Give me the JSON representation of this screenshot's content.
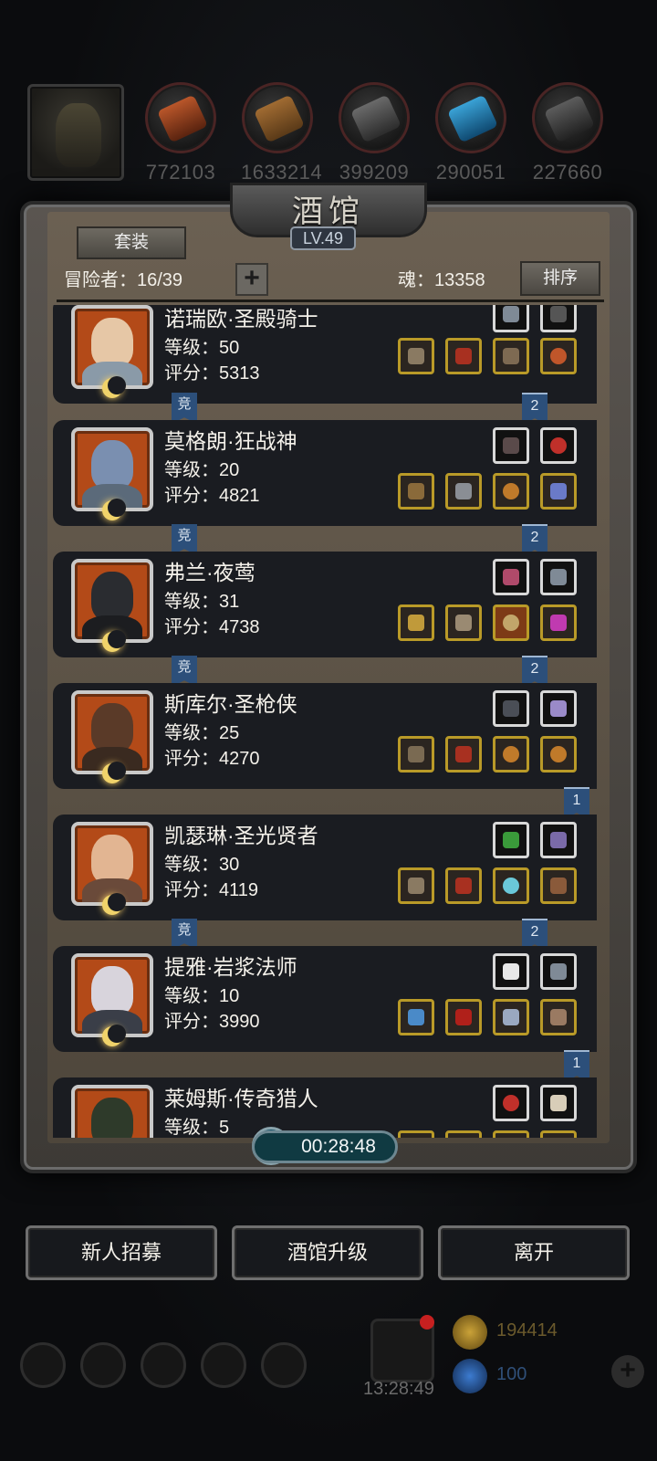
{
  "resources": [
    {
      "icon": "meat-icon",
      "value": "772103"
    },
    {
      "icon": "wood-icon",
      "value": "1633214"
    },
    {
      "icon": "stone-icon",
      "value": "399209"
    },
    {
      "icon": "crystal-icon",
      "value": "290051"
    },
    {
      "icon": "iron-icon",
      "value": "227660"
    }
  ],
  "panel": {
    "title": "酒馆",
    "level": "LV.49",
    "set_button": "套装",
    "adventurers": "冒险者：16/39",
    "soul": "魂：13358",
    "sort_button": "排序"
  },
  "heroes": [
    {
      "name": "诺瑞欧·圣殿骑士",
      "level": "等级：50",
      "score": "评分：5313",
      "competitive": "竞",
      "rank": "2"
    },
    {
      "name": "莫格朗·狂战神",
      "level": "等级：20",
      "score": "评分：4821",
      "competitive": "竞",
      "rank": "2"
    },
    {
      "name": "弗兰·夜莺",
      "level": "等级：31",
      "score": "评分：4738",
      "competitive": "竞",
      "rank": "2"
    },
    {
      "name": "斯库尔·圣枪侠",
      "level": "等级：25",
      "score": "评分：4270",
      "competitive": "",
      "rank": "1"
    },
    {
      "name": "凯瑟琳·圣光贤者",
      "level": "等级：30",
      "score": "评分：4119",
      "competitive": "竞",
      "rank": "2"
    },
    {
      "name": "提雅·岩浆法师",
      "level": "等级：10",
      "score": "评分：3990",
      "competitive": "",
      "rank": "1"
    },
    {
      "name": "莱姆斯·传奇猎人",
      "level": "等级：5",
      "score": "",
      "competitive": "",
      "rank": ""
    }
  ],
  "timer": "00:28:48",
  "buttons": {
    "recruit": "新人招募",
    "upgrade": "酒馆升级",
    "leave": "离开"
  },
  "bottom": {
    "gift_time": "13:28:49",
    "gold": "194414",
    "gems": "100"
  }
}
